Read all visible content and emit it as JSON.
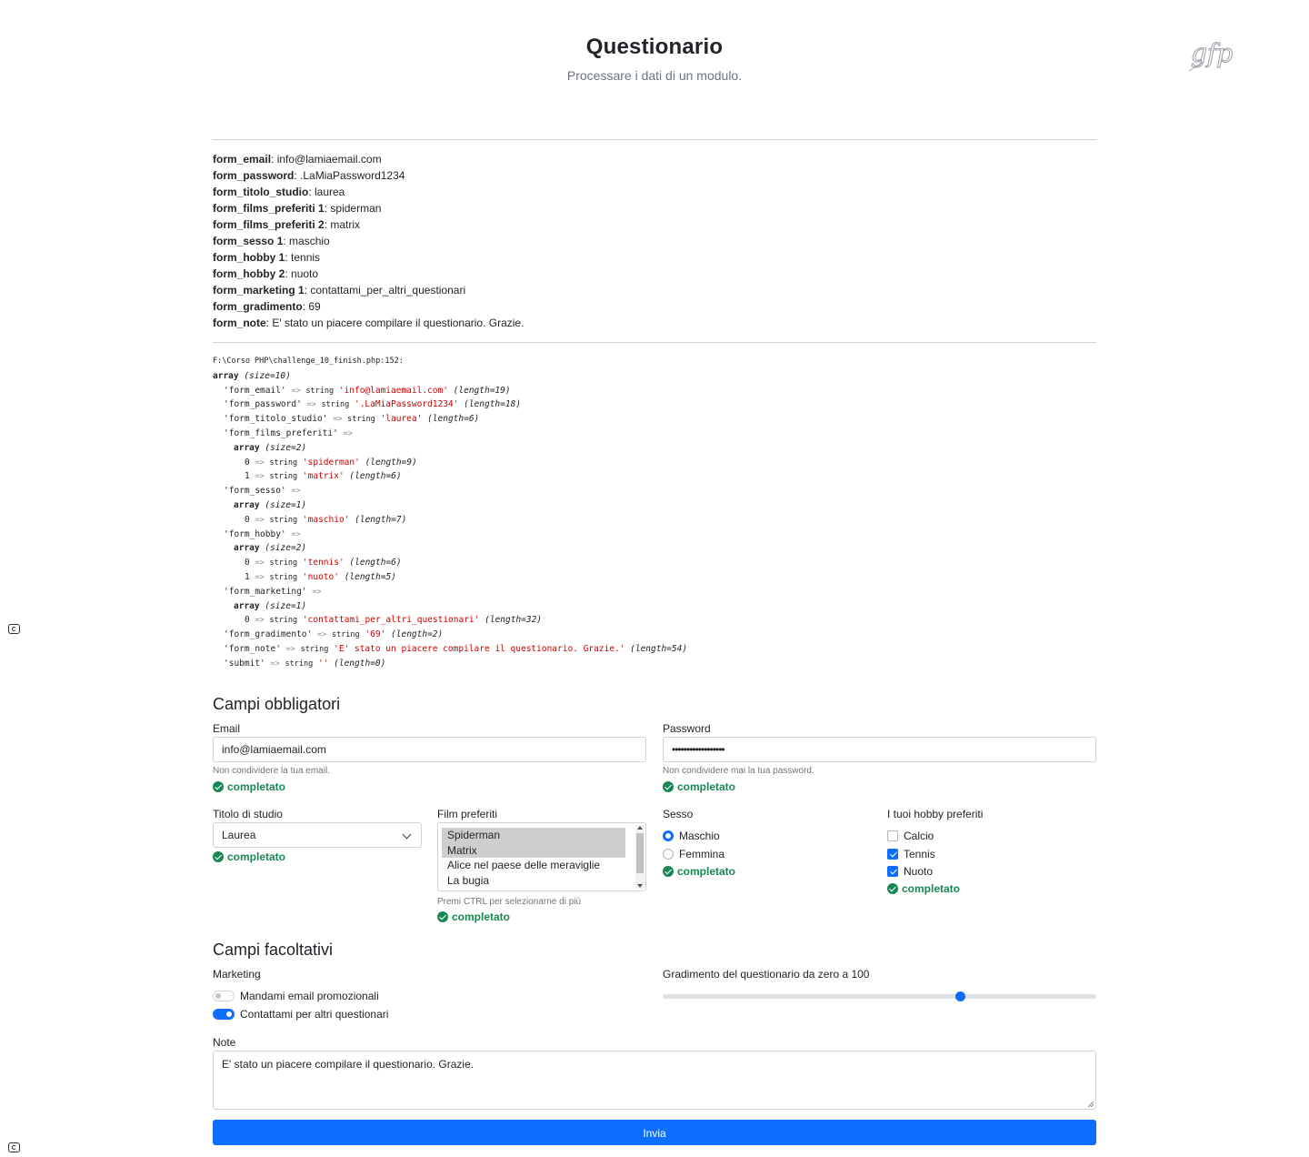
{
  "header": {
    "title": "Questionario",
    "subtitle": "Processare i dati di un modulo.",
    "logo_text": "gfp"
  },
  "summary": [
    {
      "key": "form_email",
      "value": "info@lamiaemail.com"
    },
    {
      "key": "form_password",
      "value": ".LaMiaPassword1234"
    },
    {
      "key": "form_titolo_studio",
      "value": "laurea"
    },
    {
      "key": "form_films_preferiti 1",
      "value": "spiderman"
    },
    {
      "key": "form_films_preferiti 2",
      "value": "matrix"
    },
    {
      "key": "form_sesso 1",
      "value": "maschio"
    },
    {
      "key": "form_hobby 1",
      "value": "tennis"
    },
    {
      "key": "form_hobby 2",
      "value": "nuoto"
    },
    {
      "key": "form_marketing 1",
      "value": "contattami_per_altri_questionari"
    },
    {
      "key": "form_gradimento",
      "value": "69"
    },
    {
      "key": "form_note",
      "value": "E' stato un piacere compilare il questionario. Grazie."
    }
  ],
  "dump": {
    "path": "F:\\Corso PHP\\challenge_10_finish.php:152:",
    "lines": [
      {
        "indent": 0,
        "kind": "arr",
        "text": "array",
        "meta": "(size=10)"
      },
      {
        "indent": 1,
        "kind": "str",
        "key": "'form_email'",
        "value": "'info@lamiaemail.com'",
        "meta": "(length=19)"
      },
      {
        "indent": 1,
        "kind": "str",
        "key": "'form_password'",
        "value": "'.LaMiaPassword1234'",
        "meta": "(length=18)"
      },
      {
        "indent": 1,
        "kind": "str",
        "key": "'form_titolo_studio'",
        "value": "'laurea'",
        "meta": "(length=6)"
      },
      {
        "indent": 1,
        "kind": "key",
        "key": "'form_films_preferiti'"
      },
      {
        "indent": 2,
        "kind": "arr",
        "text": "array",
        "meta": "(size=2)"
      },
      {
        "indent": 3,
        "kind": "str",
        "key": "0",
        "value": "'spiderman'",
        "meta": "(length=9)"
      },
      {
        "indent": 3,
        "kind": "str",
        "key": "1",
        "value": "'matrix'",
        "meta": "(length=6)"
      },
      {
        "indent": 1,
        "kind": "key",
        "key": "'form_sesso'"
      },
      {
        "indent": 2,
        "kind": "arr",
        "text": "array",
        "meta": "(size=1)"
      },
      {
        "indent": 3,
        "kind": "str",
        "key": "0",
        "value": "'maschio'",
        "meta": "(length=7)"
      },
      {
        "indent": 1,
        "kind": "key",
        "key": "'form_hobby'"
      },
      {
        "indent": 2,
        "kind": "arr",
        "text": "array",
        "meta": "(size=2)"
      },
      {
        "indent": 3,
        "kind": "str",
        "key": "0",
        "value": "'tennis'",
        "meta": "(length=6)"
      },
      {
        "indent": 3,
        "kind": "str",
        "key": "1",
        "value": "'nuoto'",
        "meta": "(length=5)"
      },
      {
        "indent": 1,
        "kind": "key",
        "key": "'form_marketing'"
      },
      {
        "indent": 2,
        "kind": "arr",
        "text": "array",
        "meta": "(size=1)"
      },
      {
        "indent": 3,
        "kind": "str",
        "key": "0",
        "value": "'contattami_per_altri_questionari'",
        "meta": "(length=32)"
      },
      {
        "indent": 1,
        "kind": "str",
        "key": "'form_gradimento'",
        "value": "'69'",
        "meta": "(length=2)"
      },
      {
        "indent": 1,
        "kind": "str",
        "key": "'form_note'",
        "value": "'E' stato un piacere compilare il questionario. Grazie.'",
        "meta": "(length=54)"
      },
      {
        "indent": 1,
        "kind": "str",
        "key": "'submit'",
        "value": "''",
        "meta": "(length=0)"
      }
    ],
    "arrow": "=>",
    "type_word": "string"
  },
  "required": {
    "title": "Campi obbligatori",
    "email": {
      "label": "Email",
      "value": "info@lamiaemail.com",
      "help": "Non condividere la tua email.",
      "valid": "completato"
    },
    "password": {
      "label": "Password",
      "value": "••••••••••••••••••",
      "help": "Non condividere mai la tua password.",
      "valid": "completato"
    },
    "titolo": {
      "label": "Titolo di studio",
      "value": "Laurea",
      "valid": "completato"
    },
    "film": {
      "label": "Film preferiti",
      "options": [
        {
          "label": "Spiderman",
          "selected": true
        },
        {
          "label": "Matrix",
          "selected": true
        },
        {
          "label": "Alice nel paese delle meraviglie",
          "selected": false
        },
        {
          "label": "La bugia",
          "selected": false
        }
      ],
      "help": "Premi CTRL per selezionarne di più",
      "valid": "completato"
    },
    "sesso": {
      "label": "Sesso",
      "options": [
        {
          "label": "Maschio",
          "checked": true
        },
        {
          "label": "Femmina",
          "checked": false
        }
      ],
      "valid": "completato"
    },
    "hobby": {
      "label": "I tuoi hobby preferiti",
      "options": [
        {
          "label": "Calcio",
          "checked": false
        },
        {
          "label": "Tennis",
          "checked": true
        },
        {
          "label": "Nuoto",
          "checked": true
        }
      ],
      "valid": "completato"
    }
  },
  "optional": {
    "title": "Campi facoltativi",
    "marketing": {
      "label": "Marketing",
      "options": [
        {
          "label": "Mandami email promozionali",
          "on": false
        },
        {
          "label": "Contattami per altri questionari",
          "on": true
        }
      ]
    },
    "gradimento": {
      "label": "Gradimento del questionario da zero a 100",
      "min": 0,
      "max": 100,
      "value": 69
    },
    "note": {
      "label": "Note",
      "value": "E' stato un piacere compilare il questionario. Grazie."
    }
  },
  "submit_label": "Invia",
  "colors": {
    "primary": "#0d6efd",
    "success": "#198754",
    "muted": "#6c757d",
    "dump_string": "#cc0000"
  }
}
